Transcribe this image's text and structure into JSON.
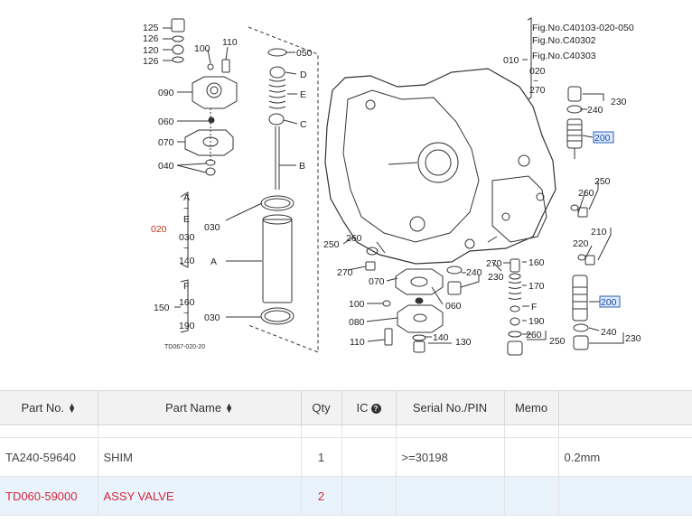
{
  "diagram": {
    "figure_refs": [
      "Fig.No.C40103-020-050",
      "Fig.No.C40302",
      "Fig.No.C40303"
    ],
    "code": "TD067-020-20",
    "callouts": {
      "c125": "125",
      "c126a": "126",
      "c120": "120",
      "c126b": "126",
      "c100a": "100",
      "c110a": "110",
      "c090": "090",
      "c060a": "060",
      "c070a": "070",
      "c040": "040",
      "c020": "020",
      "rA": "A",
      "rTilde1": "~",
      "rE": "E",
      "r030a": "030",
      "rTilde2": "~",
      "r140a": "140",
      "c030a": "030",
      "cA": "A",
      "c150": "150",
      "rF": "F",
      "r160a": "160",
      "rTilde3": "~",
      "r190a": "190",
      "c030b": "030",
      "c050": "050",
      "cD": "D",
      "cE": "E",
      "cC": "C",
      "cB": "B",
      "c010": "010",
      "r020b": "020",
      "rTilde4": "~",
      "r270a": "270",
      "c240a": "240",
      "c230a": "230",
      "c200a": "200",
      "c250a": "250",
      "c260a": "260",
      "c210": "210",
      "c220": "220",
      "c200b": "200",
      "c240b": "240",
      "c230b": "230",
      "c250b": "250",
      "c260b": "260",
      "c270b": "270",
      "c160b": "160",
      "c170": "170",
      "cF": "F",
      "c190b": "190",
      "c260c": "260",
      "c250c": "250",
      "c240c": "240",
      "c230c": "230",
      "c270c": "270",
      "c070b": "070",
      "c060b": "060",
      "c100b": "100",
      "c080": "080",
      "c110b": "110",
      "c140b": "140",
      "c130": "130",
      "c250d": "250",
      "c260d": "260"
    }
  },
  "table": {
    "columns": [
      {
        "label": "Part No.",
        "sortable": true
      },
      {
        "label": "Part Name",
        "sortable": true
      },
      {
        "label": "Qty",
        "sortable": false
      },
      {
        "label": "IC",
        "help": true
      },
      {
        "label": "Serial No./PIN",
        "sortable": false
      },
      {
        "label": "Memo",
        "sortable": false
      },
      {
        "label": "",
        "sortable": false
      }
    ],
    "rows": [
      {
        "part_no": "TA240-59640",
        "part_name": "SHIM",
        "qty": "1",
        "ic": "",
        "serial": ">=30198",
        "memo": "",
        "extra": "0.2mm"
      },
      {
        "part_no": "TD060-59000",
        "part_name": "ASSY VALVE",
        "qty": "2",
        "ic": "",
        "serial": "",
        "memo": "",
        "extra": ""
      }
    ]
  }
}
